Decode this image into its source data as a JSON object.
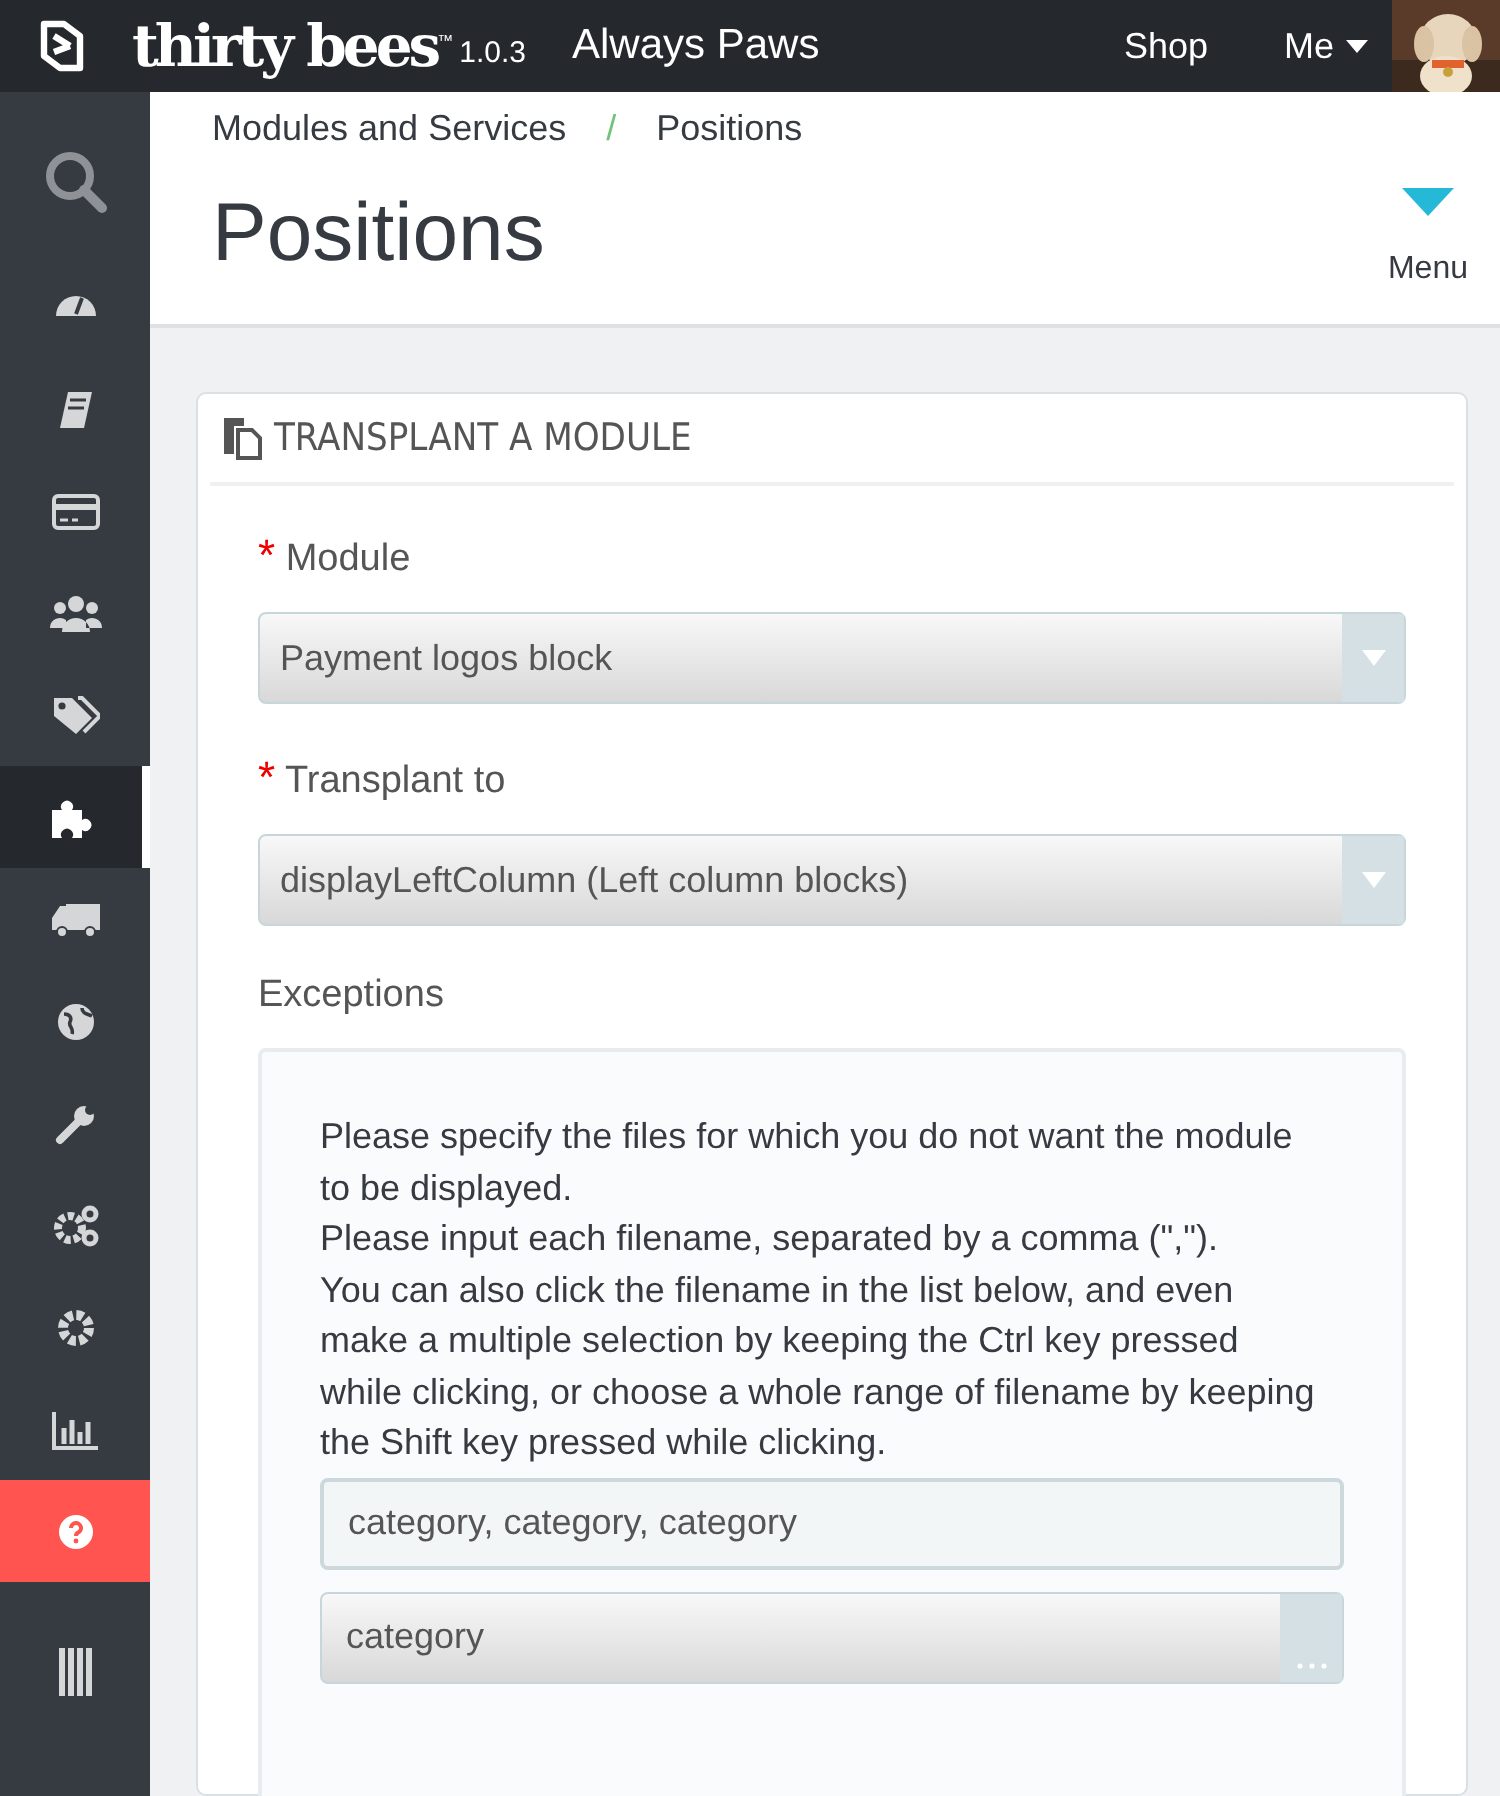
{
  "topbar": {
    "logo": "thirty bees",
    "trademark": "™",
    "version": "1.0.3",
    "shop_name": "Always Paws",
    "links": [
      "Shop",
      "Me"
    ],
    "avatar": {
      "kind": "picture"
    }
  },
  "sidebar": {
    "items": [
      {
        "selected": false,
        "highlighted": false
      },
      {
        "selected": false,
        "highlighted": false
      },
      {
        "selected": false,
        "highlighted": false
      },
      {
        "selected": false,
        "highlighted": false
      },
      {
        "selected": false,
        "highlighted": false
      },
      {
        "selected": false,
        "highlighted": false
      },
      {
        "selected": true,
        "highlighted": false
      },
      {
        "selected": false,
        "highlighted": false
      },
      {
        "selected": false,
        "highlighted": false
      },
      {
        "selected": false,
        "highlighted": false
      },
      {
        "selected": false,
        "highlighted": false
      },
      {
        "selected": false,
        "highlighted": false
      },
      {
        "selected": false,
        "highlighted": false
      },
      {
        "selected": false,
        "highlighted": true
      },
      {
        "selected": false,
        "highlighted": false
      }
    ]
  },
  "breadcrumb": [
    "Modules and Services",
    "/",
    "Positions"
  ],
  "page_title": "Positions",
  "menu_button": "Menu",
  "panel": {
    "title": "TRANSPLANT A MODULE",
    "fields": [
      {
        "label": "Module",
        "required": "*",
        "value": "Payment logos block"
      },
      {
        "label": "Transplant to",
        "required": "*",
        "value": "displayLeftColumn (Left column blocks)"
      }
    ],
    "exceptions": {
      "label": "Exceptions",
      "help": [
        "Please specify the files for which you do not want the module to be displayed.",
        "Please input each filename, separated by a comma (\",\").",
        "You can also click the filename in the list below, and even make a multiple selection by keeping the Ctrl key pressed while clicking, or choose a whole range of filename by keeping the Shift key pressed while clicking."
      ],
      "input_value": "category, category, category",
      "select_value": "category"
    }
  }
}
